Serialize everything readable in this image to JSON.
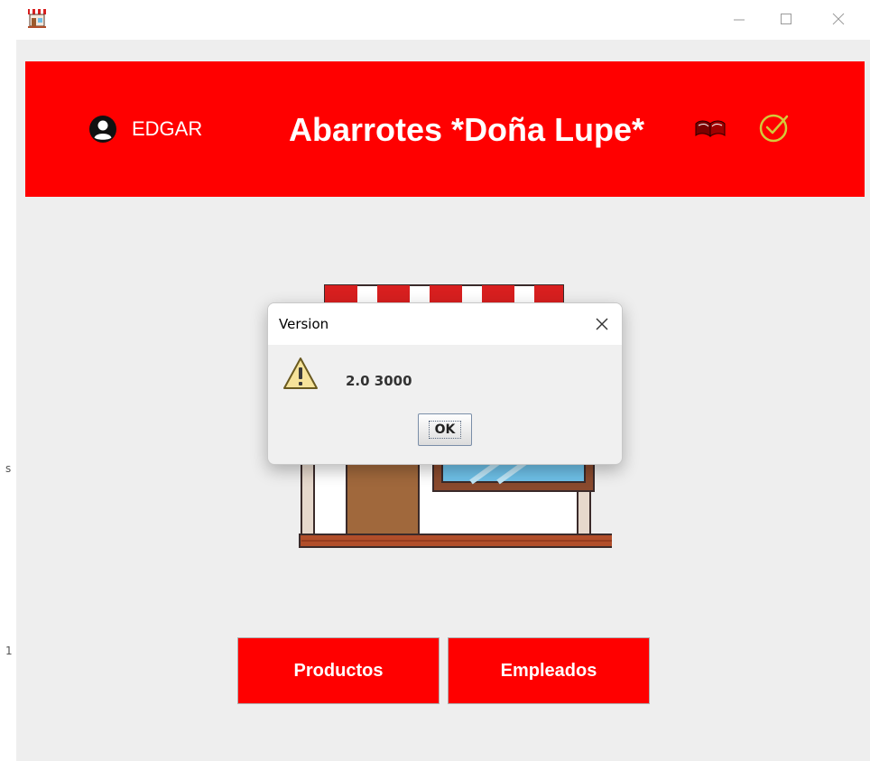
{
  "window": {
    "controls": {
      "minimize_icon": "minimize-icon",
      "maximize_icon": "maximize-icon",
      "close_icon": "close-icon"
    }
  },
  "left_edge": {
    "marks": [
      "s",
      "1"
    ]
  },
  "header": {
    "user_name": "EDGAR",
    "title": "Abarrotes *Doña Lupe*",
    "icons": [
      "user-icon",
      "book-icon",
      "check-icon"
    ],
    "color": "#ff0000",
    "check_color": "#d4c93a"
  },
  "buttons": {
    "productos": "Productos",
    "empleados": "Empleados"
  },
  "dialog": {
    "title": "Version",
    "message": "2.0 3000",
    "ok_label": "OK",
    "icon": "warning-icon"
  }
}
